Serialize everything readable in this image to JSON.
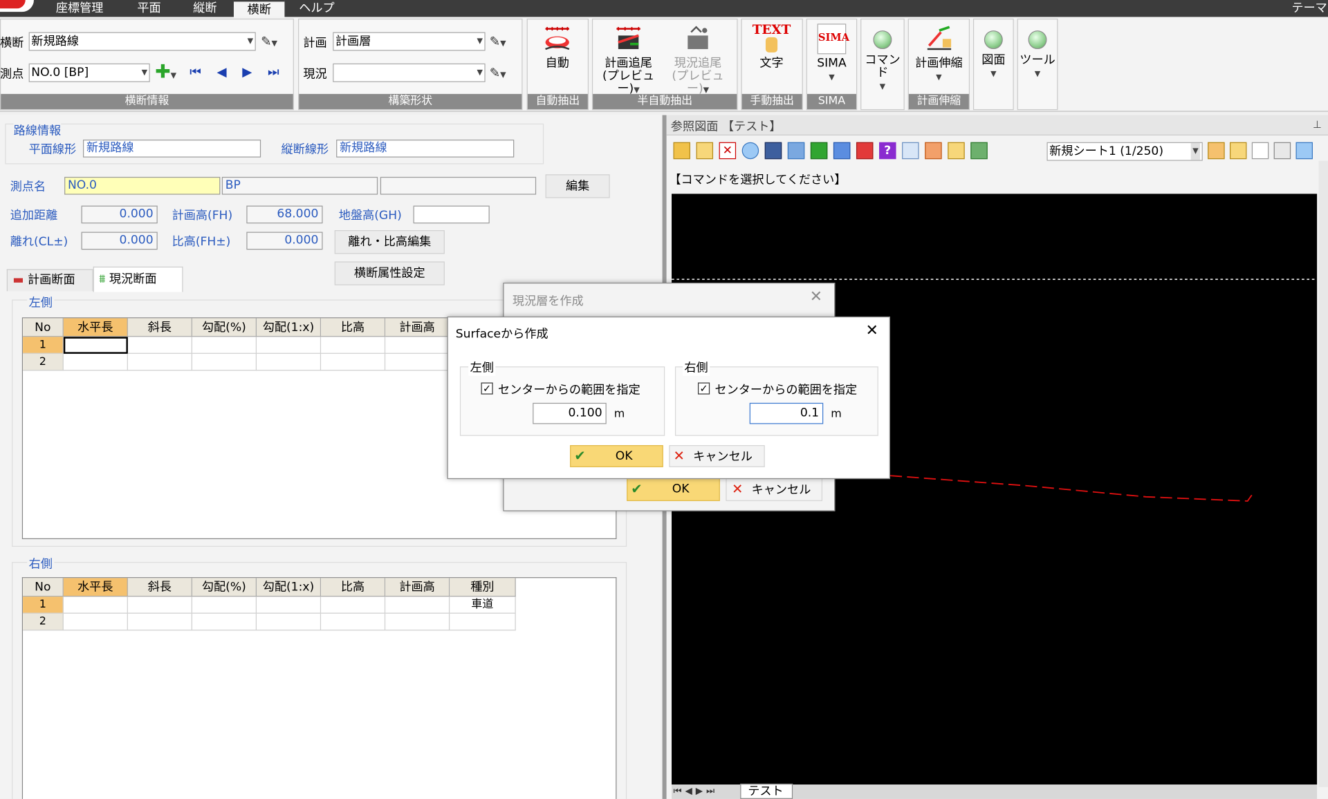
{
  "menu": {
    "items": [
      "座標管理",
      "平面",
      "縦断",
      "横断",
      "ヘルプ"
    ],
    "right_label": "テーマ",
    "active": "横断"
  },
  "ribbon": {
    "cross_label": "横断",
    "cross_value": "新規路線",
    "station_label": "測点",
    "station_value": "NO.0 [BP]",
    "plan_label": "計画",
    "plan_value": "計画層",
    "current_label": "現況",
    "current_value": "",
    "group_cross_info": "横断情報",
    "group_shape": "構築形状",
    "group_auto": "自動抽出",
    "group_semi": "半自動抽出",
    "group_manual": "手動抽出",
    "group_sima": "SIMA",
    "group_stretch": "計画伸縮",
    "btn_auto": "自動",
    "btn_plan_follow": "計画追尾\n(プレビュー)",
    "btn_plan_follow_l1": "計画追尾",
    "btn_plan_follow_l2": "(プレビュー)",
    "btn_current_follow_l1": "現況追尾",
    "btn_current_follow_l2": "(プレビュー)",
    "btn_text": "文字",
    "text_icon": "TEXT",
    "btn_sima": "SIMA",
    "sima_icon": "SIMA",
    "btn_command": "コマンド",
    "btn_stretch": "計画伸縮",
    "btn_drawing": "図面",
    "btn_tool": "ツール"
  },
  "route_info": {
    "title": "路線情報",
    "plan_label": "平面線形",
    "plan_value": "新規路線",
    "profile_label": "縦断線形",
    "profile_value": "新規路線"
  },
  "station": {
    "name_label": "測点名",
    "name_value": "NO.0",
    "name_value2": "BP",
    "name_value3": "",
    "edit_button": "編集",
    "add_dist_label": "追加距離",
    "add_dist_value": "0.000",
    "plan_h_label": "計画高(FH)",
    "plan_h_value": "68.000",
    "ground_label": "地盤高(GH)",
    "ground_value": "",
    "offset_label": "離れ(CL±)",
    "offset_value": "0.000",
    "rel_h_label": "比高(FH±)",
    "rel_h_value": "0.000",
    "offset_edit_button": "離れ・比高編集",
    "attr_button": "横断属性設定"
  },
  "tabs": [
    "計画断面",
    "現況断面"
  ],
  "left_side": {
    "title": "左側",
    "columns": [
      "No",
      "水平長",
      "斜長",
      "勾配(%)",
      "勾配(1:x)",
      "比高",
      "計画高"
    ],
    "rows": [
      [
        "1",
        "",
        "",
        "",
        "",
        "",
        ""
      ],
      [
        "2",
        "",
        "",
        "",
        "",
        "",
        ""
      ]
    ]
  },
  "right_side": {
    "title": "右側",
    "columns": [
      "No",
      "水平長",
      "斜長",
      "勾配(%)",
      "勾配(1:x)",
      "比高",
      "計画高",
      "種別"
    ],
    "rows": [
      [
        "1",
        "",
        "",
        "",
        "",
        "",
        "",
        "車道"
      ],
      [
        "2",
        "",
        "",
        "",
        "",
        "",
        "",
        ""
      ]
    ]
  },
  "view": {
    "title": "参照図面 【テスト】",
    "sheet_select": "新規シート1 (1/250)",
    "command_prompt": "【コマンドを選択してください】",
    "bottom_tab": "テスト"
  },
  "dialog_back": {
    "title": "現況層を作成",
    "ok": "OK",
    "cancel": "キャンセル"
  },
  "dialog_front": {
    "title": "Surfaceから作成",
    "left_title": "左側",
    "left_check": "センターからの範囲を指定",
    "left_value": "0.100",
    "left_unit": "m",
    "right_title": "右側",
    "right_check": "センターからの範囲を指定",
    "right_value": "0.1",
    "right_unit": "m",
    "ok": "OK",
    "cancel": "キャンセル"
  },
  "colors": {
    "accent_orange": "#f5c16e",
    "ok_yellow": "#f9d876",
    "ribbon_group": "#8a8a8a",
    "blue_text": "#2b5bbf",
    "line_red": "#e01010"
  }
}
